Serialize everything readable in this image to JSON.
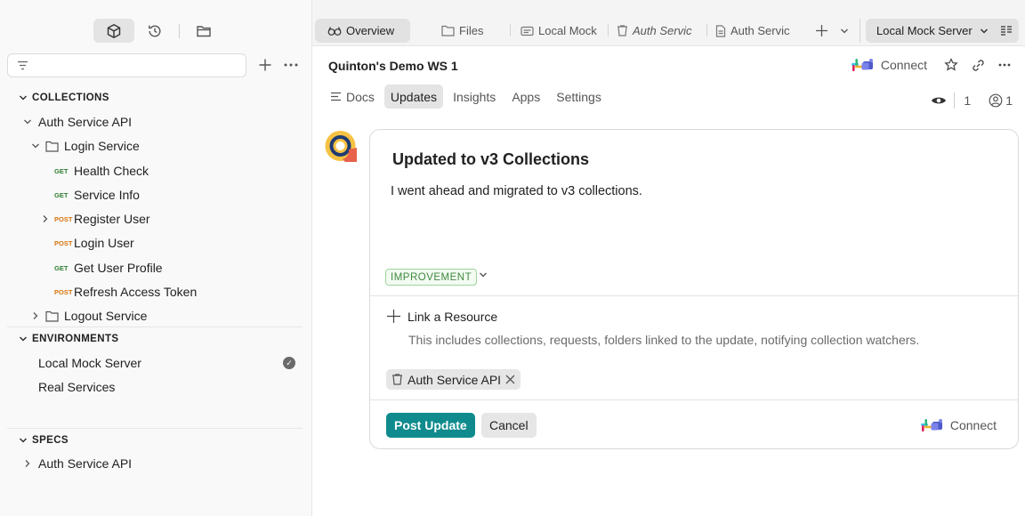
{
  "sidebar": {
    "filter_placeholder": "",
    "sections": {
      "collections": "COLLECTIONS",
      "environments": "ENVIRONMENTS",
      "specs": "SPECS"
    },
    "collection": {
      "name": "Auth Service API",
      "folder_login": "Login Service",
      "requests": [
        {
          "method": "GET",
          "name": "Health Check"
        },
        {
          "method": "GET",
          "name": "Service Info"
        },
        {
          "method": "POST",
          "name": "Register User"
        },
        {
          "method": "POST",
          "name": "Login User"
        },
        {
          "method": "GET",
          "name": "Get User Profile"
        },
        {
          "method": "POST",
          "name": "Refresh Access Token"
        }
      ],
      "folder_logout": "Logout Service"
    },
    "environments": [
      "Local Mock Server",
      "Real Services"
    ],
    "specs": [
      "Auth Service API"
    ]
  },
  "tabs": [
    {
      "label": "Overview"
    },
    {
      "label": "Files"
    },
    {
      "label": "Local Mock"
    },
    {
      "label": "Auth Servic"
    },
    {
      "label": "Auth Servic"
    }
  ],
  "environment_selector": "Local Mock Server",
  "workspace": {
    "title": "Quinton's Demo WS 1",
    "connect_label": "Connect",
    "subtabs": [
      "Docs",
      "Updates",
      "Insights",
      "Apps",
      "Settings"
    ],
    "watchers_count": "1",
    "members_count": "1"
  },
  "update": {
    "title": "Updated to v3 Collections",
    "body": "I went ahead and migrated to v3 collections.",
    "tag": "IMPROVEMENT",
    "link_resource_label": "Link a Resource",
    "link_resource_hint": "This includes collections, requests, folders linked to the update, notifying collection watchers.",
    "linked_resource": "Auth Service API",
    "post_label": "Post Update",
    "cancel_label": "Cancel",
    "connect_label": "Connect"
  },
  "colors": {
    "primary": "#0f8b8d",
    "post_method": "#d9730d",
    "get_method": "#2f7d32",
    "tag_green": "#3f8a3e"
  }
}
